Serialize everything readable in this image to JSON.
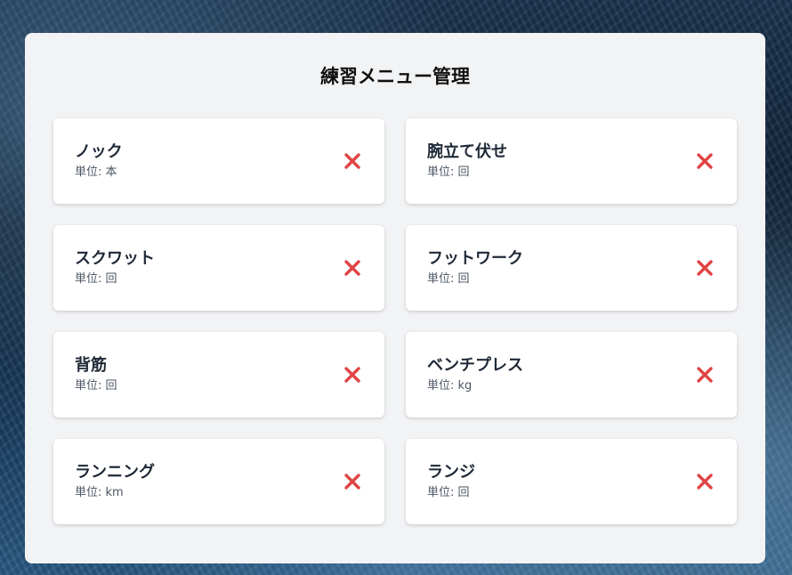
{
  "title": "練習メニュー管理",
  "colors": {
    "panel_background": "#f2f3f5",
    "card_background": "#ffffff",
    "delete_icon": "#e04444",
    "title_text": "#111111",
    "item_text": "#1f2937",
    "unit_text": "#4b5563"
  },
  "icons": {
    "delete": "close-x-icon"
  },
  "items": [
    {
      "name": "ノック",
      "unit": "単位: 本"
    },
    {
      "name": "腕立て伏せ",
      "unit": "単位: 回"
    },
    {
      "name": "スクワット",
      "unit": "単位: 回"
    },
    {
      "name": "フットワーク",
      "unit": "単位: 回"
    },
    {
      "name": "背筋",
      "unit": "単位: 回"
    },
    {
      "name": "ベンチプレス",
      "unit": "単位: kg"
    },
    {
      "name": "ランニング",
      "unit": "単位: km"
    },
    {
      "name": "ランジ",
      "unit": "単位: 回"
    }
  ]
}
